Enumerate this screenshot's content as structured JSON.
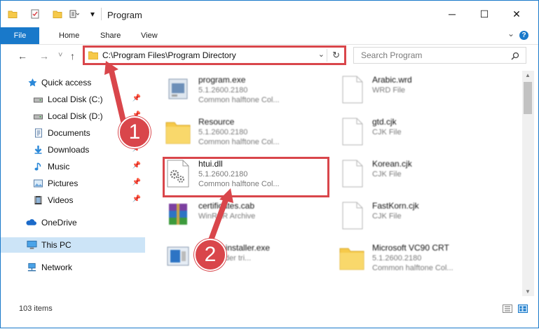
{
  "window": {
    "title": "Program",
    "minimize_glyph": "─",
    "maximize_glyph": "☐",
    "close_glyph": "✕"
  },
  "ribbon": {
    "tabs": [
      {
        "label": "File"
      },
      {
        "label": "Home"
      },
      {
        "label": "Share"
      },
      {
        "label": "View"
      }
    ],
    "help_label": "?"
  },
  "navigation": {
    "back_glyph": "←",
    "forward_glyph": "→",
    "recent_glyph": "˅",
    "up_glyph": "↑",
    "address": "C:\\Program Files\\Program Directory",
    "search_placeholder": "Search Program"
  },
  "sidebar": {
    "items": [
      {
        "label": "Quick access",
        "icon": "star-icon",
        "pinned": false
      },
      {
        "label": "Local Disk (C:)",
        "icon": "drive-icon",
        "pinned": true
      },
      {
        "label": "Local Disk (D:)",
        "icon": "drive-icon",
        "pinned": true
      },
      {
        "label": "Documents",
        "icon": "documents-icon",
        "pinned": true
      },
      {
        "label": "Downloads",
        "icon": "download-icon",
        "pinned": true
      },
      {
        "label": "Music",
        "icon": "music-icon",
        "pinned": true
      },
      {
        "label": "Pictures",
        "icon": "pictures-icon",
        "pinned": true
      },
      {
        "label": "Videos",
        "icon": "videos-icon",
        "pinned": true
      },
      {
        "label": "OneDrive",
        "icon": "cloud-icon",
        "pinned": false
      },
      {
        "label": "This PC",
        "icon": "computer-icon",
        "pinned": false,
        "selected": true
      },
      {
        "label": "Network",
        "icon": "network-icon",
        "pinned": false
      }
    ]
  },
  "files": [
    {
      "name": "program.exe",
      "line2": "5.1.2600.2180",
      "line3": "Common halftone Col...",
      "icon": "exe-icon"
    },
    {
      "name": "Arabic.wrd",
      "line2": "WRD File",
      "line3": "",
      "icon": "blank-file-icon"
    },
    {
      "name": "Resource",
      "line2": "5.1.2600.2180",
      "line3": "Common halftone Col...",
      "icon": "folder-icon"
    },
    {
      "name": "gtd.cjk",
      "line2": "CJK File",
      "line3": "",
      "icon": "blank-file-icon"
    },
    {
      "name": "htui.dll",
      "line2": "5.1.2600.2180",
      "line3": "Common halftone Col...",
      "icon": "dll-icon"
    },
    {
      "name": "Korean.cjk",
      "line2": "CJK File",
      "line3": "",
      "icon": "blank-file-icon"
    },
    {
      "name": "certificates.cab",
      "line2": "WinRAR Archive",
      "line3": "",
      "icon": "archive-icon"
    },
    {
      "name": "FastKorn.cjk",
      "line2": "CJK File",
      "line3": "",
      "icon": "blank-file-icon"
    },
    {
      "name": "commsinstaller.exe",
      "line2": "fineReader tri...",
      "line3": "",
      "icon": "installer-icon"
    },
    {
      "name": "Microsoft VC90 CRT",
      "line2": "5.1.2600.2180",
      "line3": "Common halftone Col...",
      "icon": "folder-icon"
    }
  ],
  "status": {
    "item_count": "103 items"
  },
  "callouts": {
    "step1": "1",
    "step2": "2"
  },
  "colors": {
    "accent": "#1979ca",
    "highlight": "#d9464b",
    "selected": "#cce4f7"
  }
}
